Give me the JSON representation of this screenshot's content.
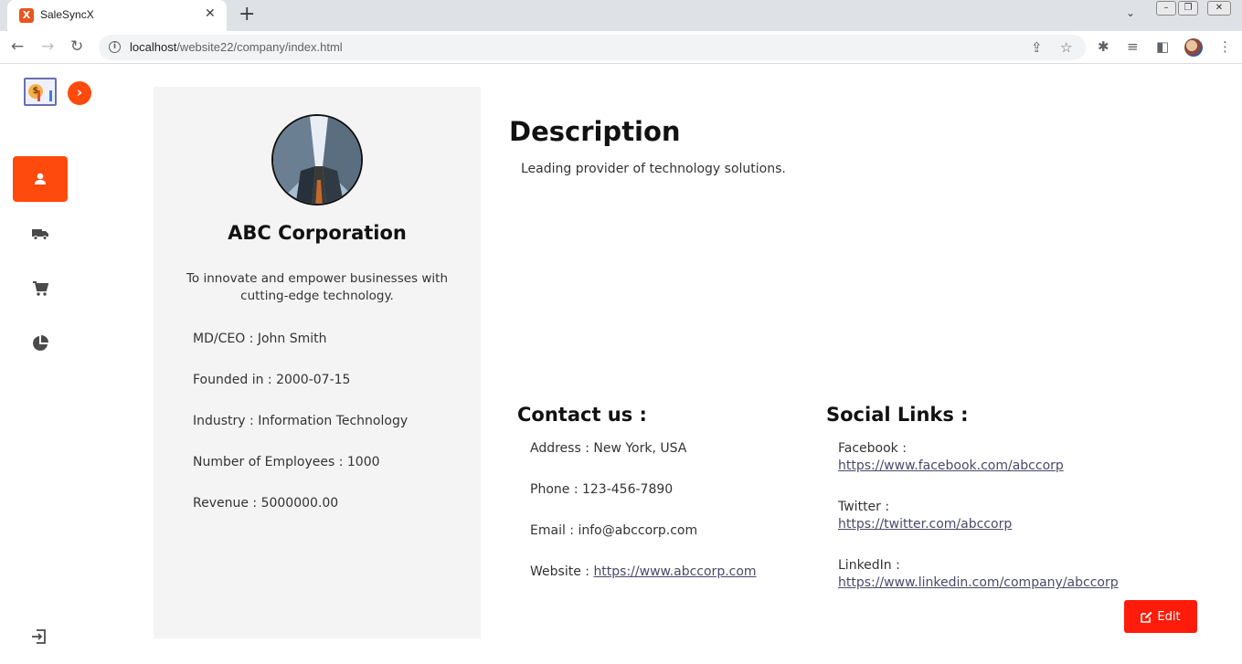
{
  "browser": {
    "tab_title": "SaleSyncX",
    "tab_favicon_glyph": "X",
    "url_host": "localhost",
    "url_path": "/website22/company/index.html",
    "close_glyph": "✕",
    "new_tab_glyph": "+"
  },
  "sidebar": {
    "toggle_glyph": "›",
    "items": [
      {
        "icon": "user-icon",
        "active": true
      },
      {
        "icon": "truck-icon",
        "active": false
      },
      {
        "icon": "cart-icon",
        "active": false
      },
      {
        "icon": "pie-chart-icon",
        "active": false
      }
    ],
    "logout_icon": "logout-icon"
  },
  "company": {
    "name": "ABC Corporation",
    "mission": "To innovate and empower businesses with cutting-edge technology.",
    "ceo": "MD/CEO : John Smith",
    "founded": "Founded in : 2000-07-15",
    "industry": "Industry : Information Technology",
    "employees": "Number of Employees : 1000",
    "revenue": "Revenue : 5000000.00"
  },
  "description": {
    "title": "Description",
    "text": "Leading provider of technology solutions."
  },
  "contact": {
    "title": "Contact us :",
    "address": "Address : New York, USA",
    "phone": "Phone : 123-456-7890",
    "email": "Email : info@abccorp.com",
    "website_label": "Website :",
    "website_url": "https://www.abccorp.com"
  },
  "social": {
    "title": "Social Links :",
    "facebook_label": "Facebook :",
    "facebook_url": "https://www.facebook.com/abccorp",
    "twitter_label": "Twitter :",
    "twitter_url": "https://twitter.com/abccorp",
    "linkedin_label": "LinkedIn :",
    "linkedin_url": "https://www.linkedin.com/company/abccorp"
  },
  "actions": {
    "edit_label": "Edit"
  },
  "colors": {
    "accent": "#ff4a0d",
    "edit_button": "#ff1c0a",
    "panel_bg": "#f4f4f4"
  }
}
